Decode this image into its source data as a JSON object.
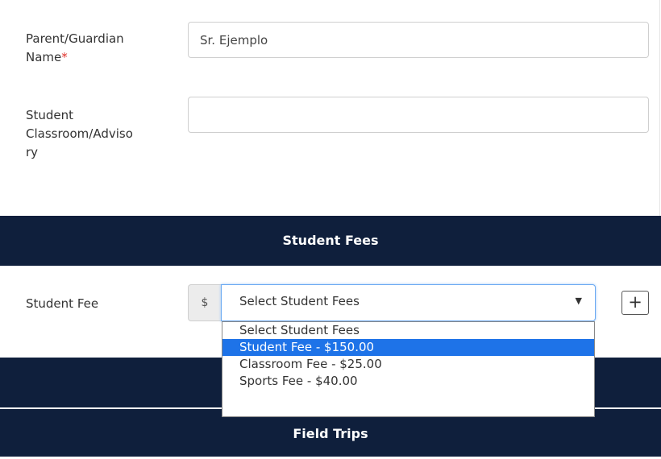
{
  "form": {
    "parent_label": "Parent/Guardian",
    "parent_label_line2": "Name",
    "required_mark": "*",
    "parent_value": "Sr. Ejemplo",
    "classroom_label_line1": "Student",
    "classroom_label_line2": "Classroom/Adviso",
    "classroom_label_line3": "ry",
    "classroom_value": ""
  },
  "sections": {
    "student_fees": "Student Fees",
    "field_trips": "Field Trips"
  },
  "fee": {
    "label": "Student Fee",
    "currency": "$",
    "selected": "Select Student Fees",
    "options": [
      "Select Student Fees",
      "Student Fee - $150.00",
      "Classroom Fee - $25.00",
      "Sports Fee - $40.00"
    ],
    "highlighted_index": 1,
    "add_label": "+"
  },
  "colors": {
    "band": "#0f1f3c",
    "highlight": "#1e73e8",
    "required": "#e0312b"
  },
  "icons": {
    "dropdown_arrow": "caret-down-icon",
    "add": "plus-icon"
  }
}
